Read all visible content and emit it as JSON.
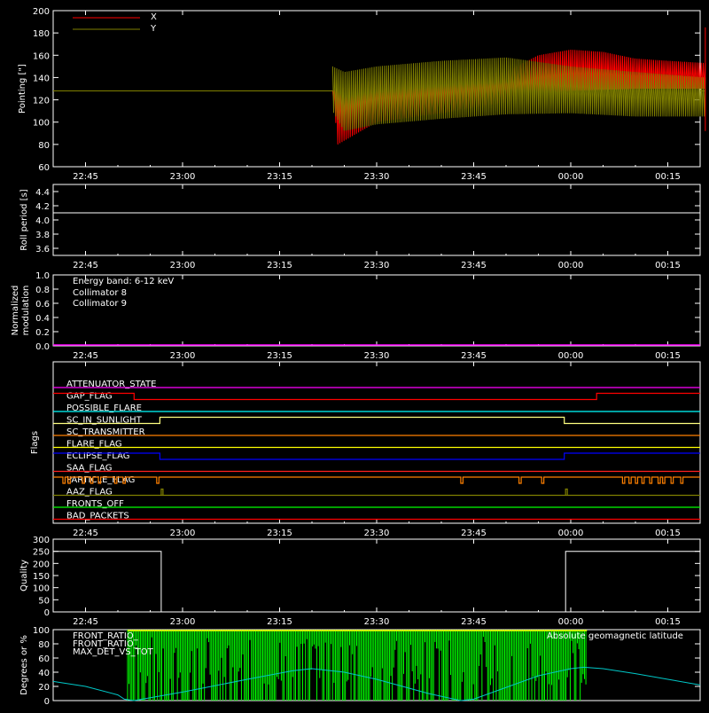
{
  "time_ticks": [
    "22:45",
    "23:00",
    "23:15",
    "23:30",
    "23:45",
    "00:00",
    "00:15"
  ],
  "colors": {
    "background": "#000000",
    "axes": "#ffffff",
    "x_series": "#ff0000",
    "y_series": "#808000",
    "collimator8": "#00ffff",
    "collimator9": "#ff00ff",
    "front_ratio_a": "#ffff00",
    "front_ratio_b": "#00ff00",
    "max_det": "#ff8000",
    "latitude": "#00c8c8"
  },
  "chart_data": [
    {
      "type": "line",
      "id": "pointing",
      "ylabel": "Pointing [\"]",
      "ylim": [
        60,
        200
      ],
      "yticks": [
        60,
        80,
        100,
        120,
        140,
        160,
        180,
        200
      ],
      "xlim_minutes": [
        -20,
        80
      ],
      "series": [
        {
          "name": "X",
          "baseline": 128,
          "active_start": 23.2,
          "active_end": 80.8,
          "upper": [
            [
              23.2,
              128
            ],
            [
              24,
              130
            ],
            [
              30,
              138
            ],
            [
              40,
              140
            ],
            [
              50,
              145
            ],
            [
              55,
              160
            ],
            [
              60,
              165
            ],
            [
              65,
              163
            ],
            [
              70,
              157
            ],
            [
              75,
              155
            ],
            [
              80.8,
              153
            ]
          ],
          "lower": [
            [
              23.2,
              128
            ],
            [
              24,
              80
            ],
            [
              30,
              100
            ],
            [
              40,
              108
            ],
            [
              50,
              118
            ],
            [
              55,
              125
            ],
            [
              60,
              128
            ],
            [
              70,
              130
            ],
            [
              80.8,
              130
            ]
          ]
        },
        {
          "name": "Y",
          "baseline": 128,
          "active_start": 23.2,
          "active_end": 80.8,
          "upper": [
            [
              23.2,
              150
            ],
            [
              25,
              145
            ],
            [
              30,
              150
            ],
            [
              40,
              155
            ],
            [
              50,
              158
            ],
            [
              60,
              150
            ],
            [
              70,
              145
            ],
            [
              80.8,
              140
            ]
          ],
          "lower": [
            [
              23.2,
              110
            ],
            [
              25,
              92
            ],
            [
              30,
              98
            ],
            [
              40,
              103
            ],
            [
              50,
              107
            ],
            [
              60,
              108
            ],
            [
              70,
              105
            ],
            [
              80.8,
              105
            ]
          ]
        }
      ]
    },
    {
      "type": "line",
      "id": "roll_period",
      "ylabel": "Roll period [s]",
      "ylim": [
        3.5,
        4.5
      ],
      "yticks": [
        3.6,
        3.8,
        4.0,
        4.2,
        4.4
      ],
      "value": 4.1
    },
    {
      "type": "line",
      "id": "modulation",
      "ylabel": "Normalized modulation",
      "ylim": [
        0,
        1
      ],
      "yticks": [
        0.0,
        0.2,
        0.4,
        0.6,
        0.8,
        1.0
      ],
      "annotation": "Energy band: 6-12 keV",
      "series": [
        {
          "name": "Collimator 8",
          "value": 0.0
        },
        {
          "name": "Collimator 9",
          "value": 0.0
        }
      ]
    },
    {
      "type": "line",
      "id": "flags",
      "ylabel": "Flags",
      "flags": [
        {
          "name": "ATTENUATOR_STATE",
          "color": "#ff00ff",
          "segments": [
            [
              -20,
              80,
              0
            ]
          ]
        },
        {
          "name": "GAP_FLAG",
          "color": "#ff0000",
          "segments": [
            [
              -20,
              -7.5,
              1
            ],
            [
              -7.5,
              64,
              0
            ],
            [
              64,
              80,
              1
            ]
          ]
        },
        {
          "name": "POSSIBLE_FLARE",
          "color": "#00ffff",
          "segments": [
            [
              -20,
              80,
              0
            ]
          ]
        },
        {
          "name": "SC_IN_SUNLIGHT",
          "color": "#ffff80",
          "segments": [
            [
              -20,
              -3.5,
              0
            ],
            [
              -3.5,
              59,
              1
            ],
            [
              59,
              80,
              0
            ]
          ]
        },
        {
          "name": "SC_TRANSMITTER",
          "color": "#ff8000",
          "segments": [
            [
              -20,
              80,
              0
            ]
          ]
        },
        {
          "name": "FLARE_FLAG",
          "color": "#ffff00",
          "segments": [
            [
              -20,
              80,
              0
            ]
          ]
        },
        {
          "name": "ECLIPSE_FLAG",
          "color": "#0000ff",
          "segments": [
            [
              -20,
              -3.5,
              1
            ],
            [
              -3.5,
              59,
              0
            ],
            [
              59,
              80,
              1
            ]
          ]
        },
        {
          "name": "SAA_FLAG",
          "color": "#ff2020",
          "segments": [
            [
              -20,
              80,
              0
            ]
          ]
        },
        {
          "name": "PARTICLE_FLAG",
          "color": "#ff8000",
          "segments": [
            [
              -20,
              80,
              1
            ]
          ],
          "drops": [
            -18.5,
            -17.7,
            -15.5,
            -14.2,
            -13,
            -10.5,
            -9.2,
            -4,
            43,
            52,
            55.5,
            68,
            69,
            70,
            71,
            72.2,
            73.5,
            74.2,
            75.5,
            77
          ]
        },
        {
          "name": "AAZ_FLAG",
          "color": "#808000",
          "segments": [
            [
              -20,
              80,
              0
            ]
          ],
          "spikes": [
            -3.3,
            59.2
          ]
        },
        {
          "name": "FRONTS_OFF",
          "color": "#00ff00",
          "segments": [
            [
              -20,
              80,
              0
            ]
          ]
        },
        {
          "name": "BAD_PACKETS",
          "color": "#ff0000",
          "segments": [
            [
              -20,
              80,
              0
            ]
          ]
        }
      ]
    },
    {
      "type": "line",
      "id": "quality",
      "ylabel": "Quality",
      "ylim": [
        0,
        300
      ],
      "yticks": [
        0,
        50,
        100,
        150,
        200,
        250,
        300
      ],
      "segments": [
        [
          -20,
          -3.3,
          250
        ],
        [
          -3.3,
          59.2,
          0
        ],
        [
          59.2,
          80,
          250
        ]
      ]
    },
    {
      "type": "line",
      "id": "ratios",
      "ylabel": "Degrees or %",
      "ylim": [
        0,
        100
      ],
      "yticks": [
        0,
        20,
        40,
        60,
        80,
        100
      ],
      "series": [
        {
          "name": "FRONT_RATIO_",
          "color": "#ffff00"
        },
        {
          "name": "FRONT_RATIO_",
          "color": "#00ff00"
        },
        {
          "name": "MAX_DET_VS_TOT",
          "color": "#ff8000"
        }
      ],
      "green_range": [
        -8.5,
        62.5
      ],
      "latitude": {
        "name": "Absolute geomagnetic latitude",
        "points": [
          [
            -20,
            27
          ],
          [
            -15,
            20
          ],
          [
            -10,
            8
          ],
          [
            -9,
            2
          ],
          [
            -7.5,
            0
          ],
          [
            0,
            12
          ],
          [
            10,
            30
          ],
          [
            17,
            42
          ],
          [
            20,
            45
          ],
          [
            25,
            40
          ],
          [
            30,
            30
          ],
          [
            38,
            10
          ],
          [
            43,
            0
          ],
          [
            45,
            2
          ],
          [
            55,
            35
          ],
          [
            60,
            45
          ],
          [
            62,
            47
          ],
          [
            65,
            45
          ],
          [
            70,
            38
          ],
          [
            75,
            30
          ],
          [
            80,
            22
          ]
        ]
      }
    }
  ]
}
